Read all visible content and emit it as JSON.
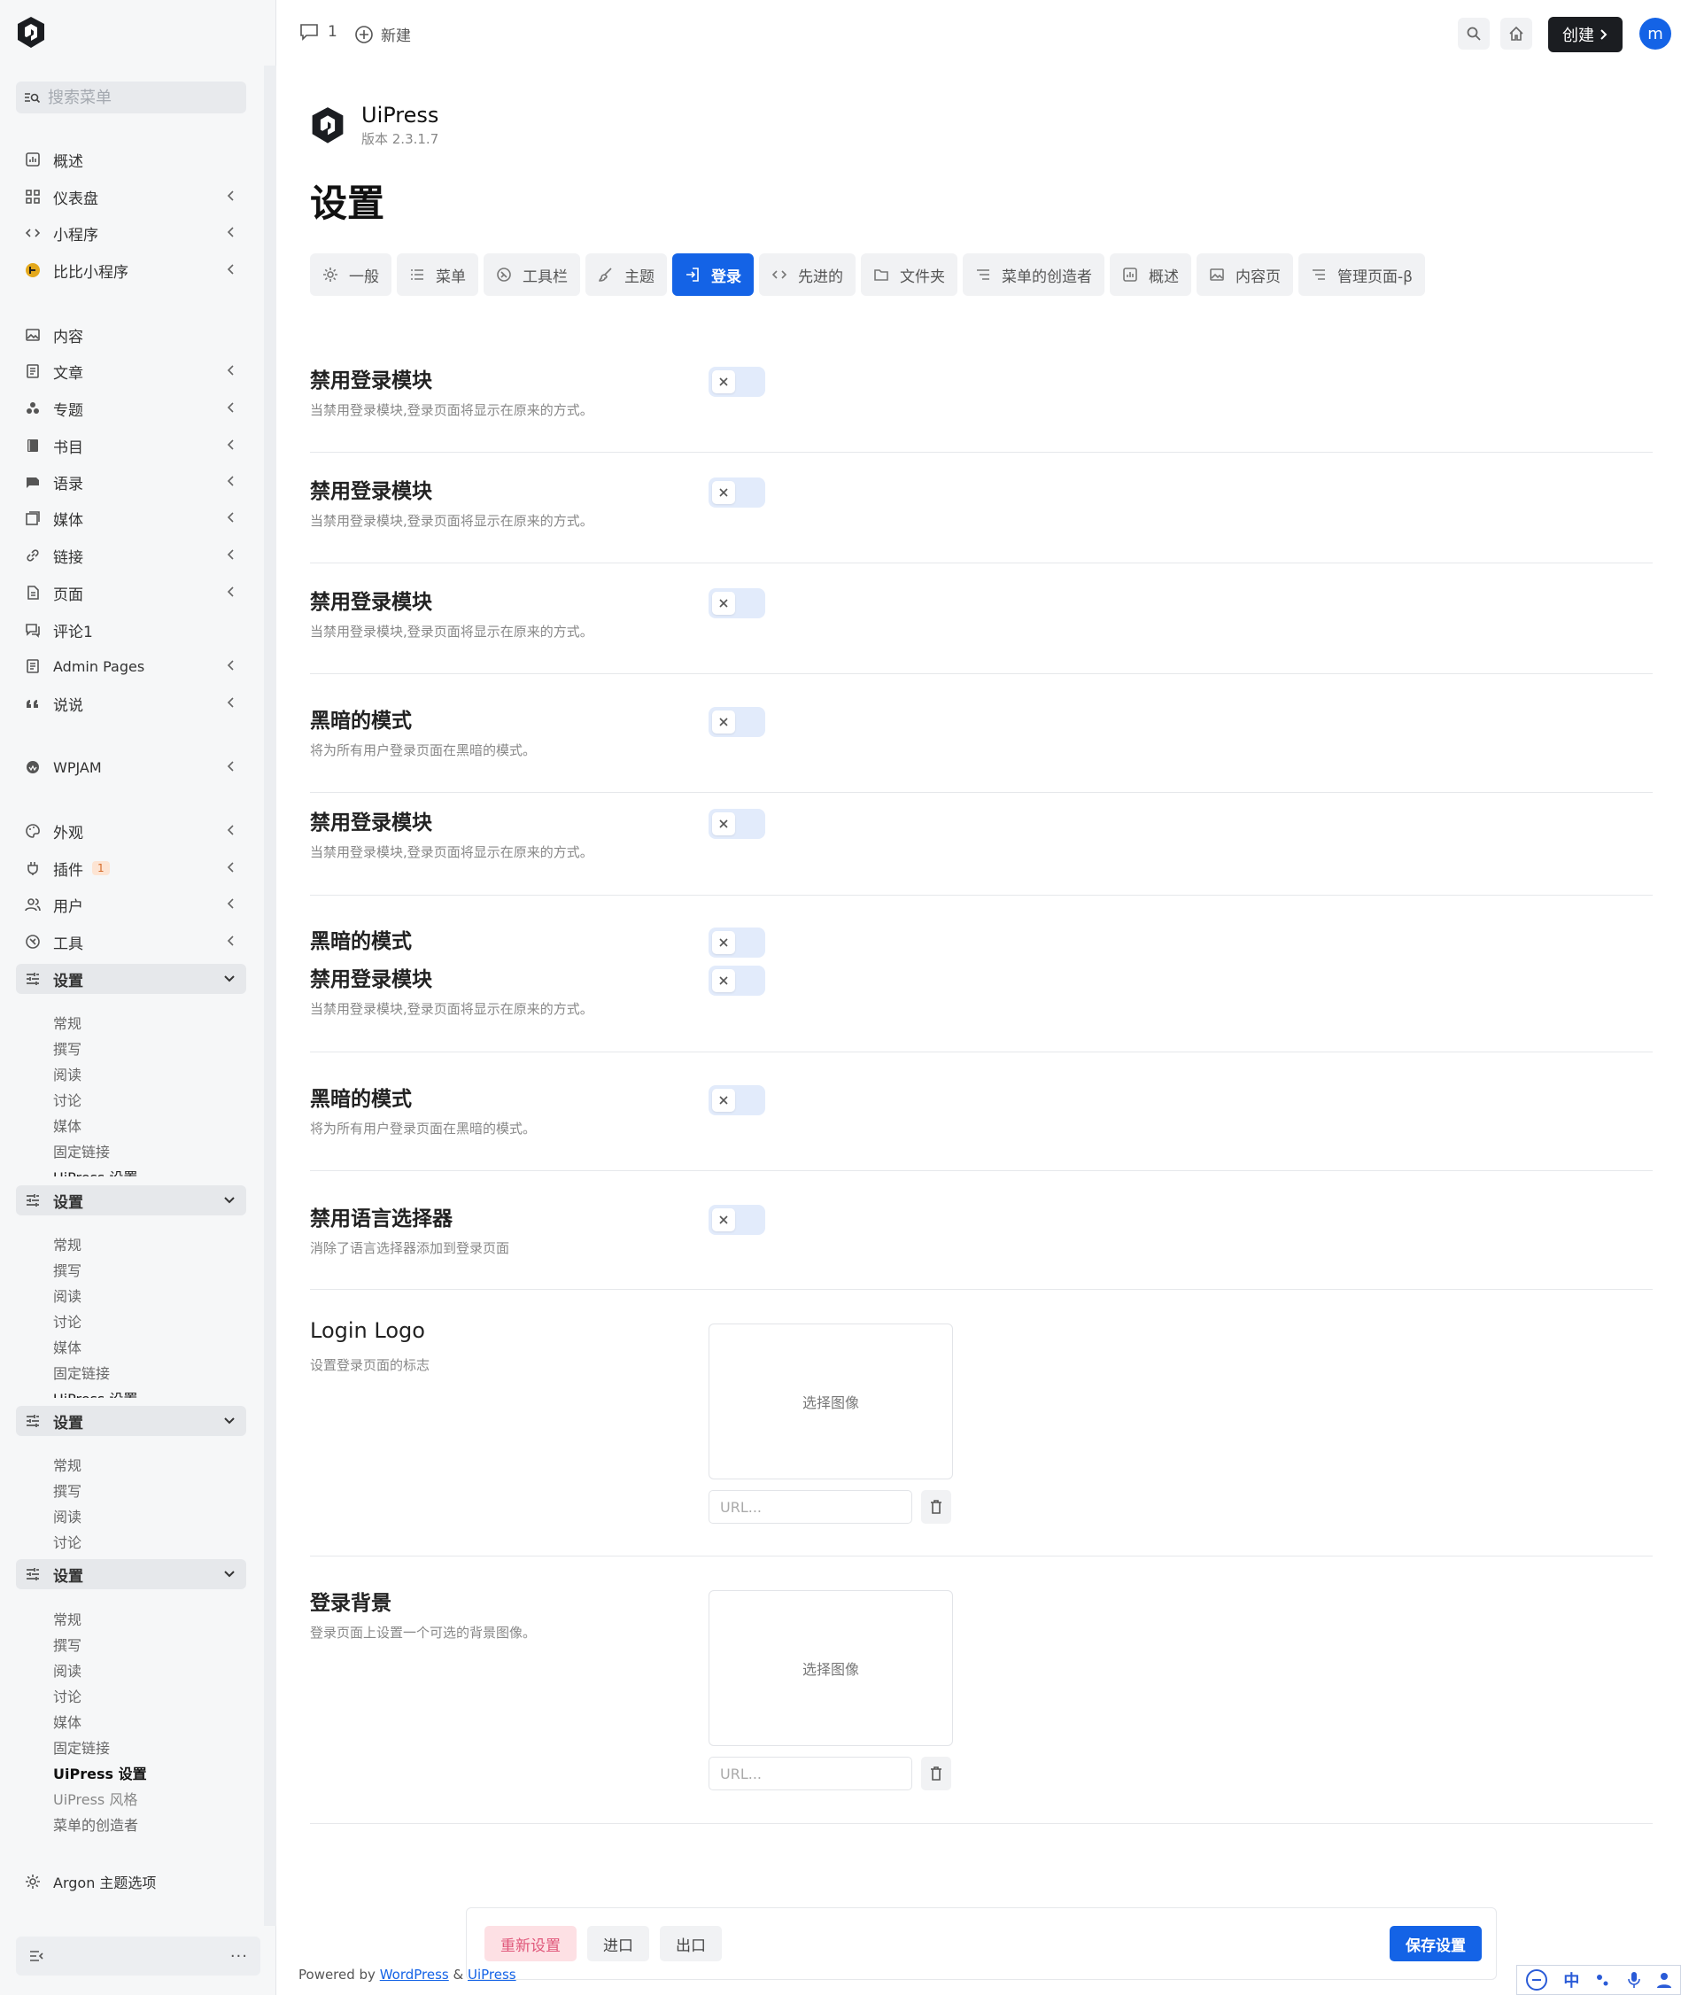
{
  "sidebar": {
    "search_placeholder": "搜索菜单",
    "items": [
      {
        "label": "概述",
        "icon": "chart-icon"
      },
      {
        "label": "仪表盘",
        "icon": "grid-icon"
      },
      {
        "label": "小程序",
        "icon": "code-icon"
      },
      {
        "label": "比比小程序",
        "icon": "app-icon"
      },
      {
        "label": "内容",
        "icon": "image-icon"
      },
      {
        "label": "文章",
        "icon": "doc-icon"
      },
      {
        "label": "专题",
        "icon": "topic-icon"
      },
      {
        "label": "书目",
        "icon": "book-icon"
      },
      {
        "label": "语录",
        "icon": "quote-icon"
      },
      {
        "label": "媒体",
        "icon": "media-icon"
      },
      {
        "label": "链接",
        "icon": "link-icon"
      },
      {
        "label": "页面",
        "icon": "page-icon"
      },
      {
        "label": "评论1",
        "icon": "comment-icon"
      },
      {
        "label": "Admin Pages",
        "icon": "doc-icon"
      },
      {
        "label": "说说",
        "icon": "quote-mark-icon"
      },
      {
        "label": "WPJAM",
        "icon": "wpjam-icon"
      },
      {
        "label": "外观",
        "icon": "palette-icon"
      },
      {
        "label": "插件",
        "icon": "plugin-icon",
        "badge": "1"
      },
      {
        "label": "用户",
        "icon": "users-icon"
      },
      {
        "label": "工具",
        "icon": "tools-icon"
      },
      {
        "label": "设置",
        "icon": "settings-icon"
      },
      {
        "label": "设置",
        "icon": "settings-icon"
      },
      {
        "label": "设置",
        "icon": "settings-icon"
      },
      {
        "label": "设置",
        "icon": "settings-icon"
      },
      {
        "label": "Argon 主题选项",
        "icon": "gear-icon"
      }
    ],
    "sub1": [
      "常规",
      "撰写",
      "阅读",
      "讨论",
      "媒体",
      "固定链接",
      "UiPress 设置"
    ],
    "sub2": [
      "常规",
      "撰写",
      "阅读",
      "讨论",
      "媒体",
      "固定链接",
      "UiPress 设置"
    ],
    "sub3": [
      "常规",
      "撰写",
      "阅读",
      "讨论"
    ],
    "sub4": [
      "常规",
      "撰写",
      "阅读",
      "讨论",
      "媒体",
      "固定链接",
      "UiPress 设置",
      "UiPress 风格",
      "菜单的创造者"
    ]
  },
  "topbar": {
    "comments_count": "1",
    "new_label": "新建",
    "create_label": "创建",
    "avatar_letter": "m"
  },
  "app": {
    "name": "UiPress",
    "version": "版本 2.3.1.7"
  },
  "page_title": "设置",
  "tabs": [
    {
      "label": "一般",
      "icon": "gear-icon"
    },
    {
      "label": "菜单",
      "icon": "list-icon"
    },
    {
      "label": "工具栏",
      "icon": "toolbar-icon"
    },
    {
      "label": "主题",
      "icon": "brush-icon"
    },
    {
      "label": "登录",
      "icon": "login-icon",
      "active": true
    },
    {
      "label": "先进的",
      "icon": "code-icon"
    },
    {
      "label": "文件夹",
      "icon": "folder-icon"
    },
    {
      "label": "菜单的创造者",
      "icon": "menu-icon"
    },
    {
      "label": "概述",
      "icon": "chart-icon"
    },
    {
      "label": "内容页",
      "icon": "image-icon"
    },
    {
      "label": "管理页面-β",
      "icon": "menu-icon"
    }
  ],
  "settings": [
    {
      "title": "禁用登录模块",
      "desc": "当禁用登录模块,登录页面将显示在原来的方式。"
    },
    {
      "title": "禁用登录模块",
      "desc": "当禁用登录模块,登录页面将显示在原来的方式。"
    },
    {
      "title": "禁用登录模块",
      "desc": "当禁用登录模块,登录页面将显示在原来的方式。"
    },
    {
      "title": "黑暗的模式",
      "desc": "将为所有用户登录页面在黑暗的模式。"
    },
    {
      "title": "禁用登录模块",
      "desc": "当禁用登录模块,登录页面将显示在原来的方式。"
    },
    {
      "title": "黑暗的模式",
      "desc": ""
    },
    {
      "title": "禁用登录模块",
      "desc": "当禁用登录模块,登录页面将显示在原来的方式。"
    },
    {
      "title": "黑暗的模式",
      "desc": "将为所有用户登录页面在黑暗的模式。"
    },
    {
      "title": "禁用语言选择器",
      "desc": "消除了语言选择器添加到登录页面"
    }
  ],
  "login_logo": {
    "title": "Login Logo",
    "desc": "设置登录页面的标志",
    "choose": "选择图像",
    "url_placeholder": "URL..."
  },
  "login_bg": {
    "title": "登录背景",
    "desc": "登录页面上设置一个可选的背景图像。",
    "choose": "选择图像",
    "url_placeholder": "URL..."
  },
  "footer": {
    "reset": "重新设置",
    "import": "进口",
    "export": "出口",
    "save": "保存设置"
  },
  "powered": {
    "prefix": "Powered by ",
    "wp": "WordPress",
    "amp": " & ",
    "uipress": "UiPress"
  },
  "ime": {
    "lang": "中"
  },
  "colors": {
    "accent": "#1463e6",
    "dark": "#1b1d21",
    "reset_bg": "#fde0e4"
  }
}
